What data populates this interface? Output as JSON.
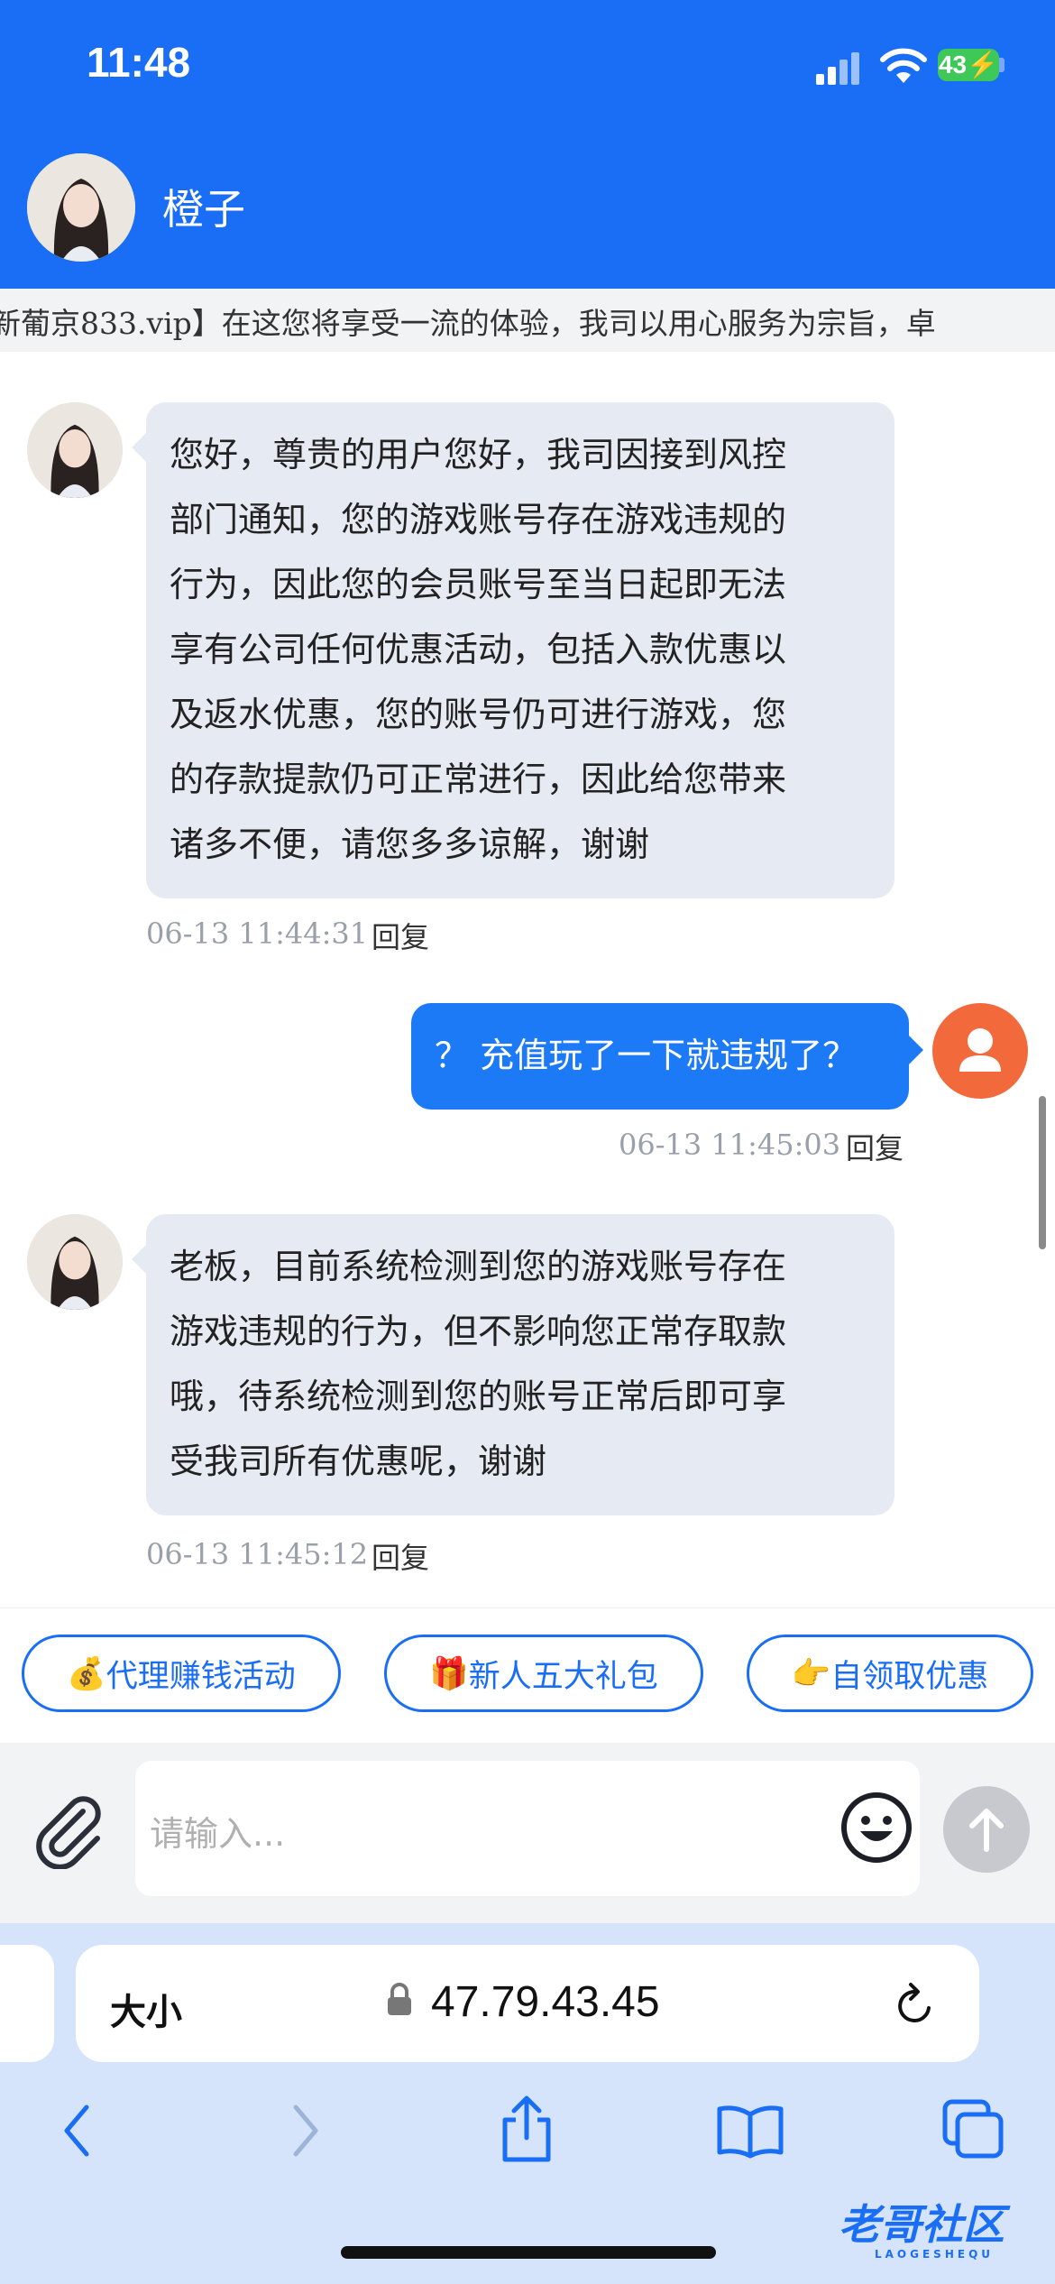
{
  "status_bar": {
    "time": "11:48",
    "battery": "43"
  },
  "header": {
    "contact_name": "橙子"
  },
  "marquee": {
    "text": "新葡京833.vip】在这您将享受一流的体验，我司以用心服务为宗旨，卓"
  },
  "messages": [
    {
      "side": "incoming",
      "lines": [
        "您好，尊贵的用户您好，我司因接到风控",
        "部门通知，您的游戏账号存在游戏违规的",
        "行为，因此您的会员账号至当日起即无法",
        "享有公司任何优惠活动，包括入款优惠以",
        "及返水优惠，您的账号仍可进行游戏，您",
        "的存款提款仍可正常进行，因此给您带来",
        "诸多不便，请您多多谅解，谢谢"
      ],
      "time": "06-13 11:44:31",
      "reply": "回复"
    },
    {
      "side": "outgoing",
      "lines": [
        "？ 充值玩了一下就违规了？"
      ],
      "time": "06-13 11:45:03",
      "reply": "回复"
    },
    {
      "side": "incoming",
      "lines": [
        "老板，目前系统检测到您的游戏账号存在",
        "游戏违规的行为，但不影响您正常存取款",
        "哦，待系统检测到您的账号正常后即可享",
        "受我司所有优惠呢，谢谢"
      ],
      "time": "06-13 11:45:12",
      "reply": "回复"
    }
  ],
  "quick_buttons": [
    {
      "emoji": "💰",
      "label": "代理赚钱活动"
    },
    {
      "emoji": "🎁",
      "label": "新人五大礼包"
    },
    {
      "emoji": "👉",
      "label": "自领取优惠"
    }
  ],
  "input": {
    "placeholder": "请输入..."
  },
  "browser": {
    "text_size_label": "大小",
    "url": "47.79.43.45"
  },
  "watermark": {
    "text": "老哥社区",
    "sub": "LAOGESHEQU"
  }
}
